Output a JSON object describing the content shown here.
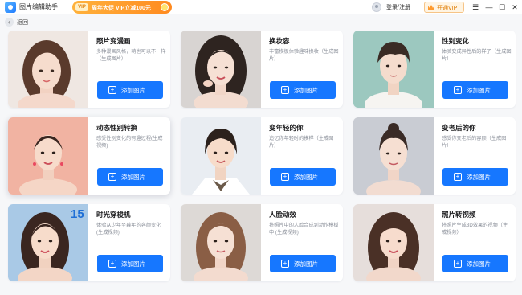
{
  "app": {
    "title": "图片编辑助手",
    "promo": {
      "vip_tag": "VIP",
      "text": "周年大促 VIP立减100元"
    },
    "login": "登录/注册",
    "vip_button": "开通VIP",
    "window_controls": {
      "menu": "☰",
      "minimize": "—",
      "maximize": "☐",
      "close": "✕"
    }
  },
  "nav": {
    "back_icon": "‹",
    "back_label": "返回"
  },
  "cards": [
    {
      "title": "照片变漫画",
      "desc": "多种漫画风格，萌也可以不一样（生成图片）",
      "button": "添加图片",
      "icon": "plus-icon"
    },
    {
      "title": "换妆容",
      "desc": "丰富模板体验趣味换妆（生成图片）",
      "button": "添加图片",
      "icon": "plus-icon"
    },
    {
      "title": "性别变化",
      "desc": "体验变成异性后的样子（生成图片）",
      "button": "添加图片",
      "icon": "plus-icon"
    },
    {
      "title": "动态性别转换",
      "desc": "感受性别变化的有趣过程(生成视频)",
      "button": "添加图片",
      "icon": "plus-icon"
    },
    {
      "title": "变年轻的你",
      "desc": "追忆你年轻时的模样（生成图片）",
      "button": "添加图片",
      "icon": "plus-icon"
    },
    {
      "title": "变老后的你",
      "desc": "感受你变老后的容颜（生成图片）",
      "button": "添加图片",
      "icon": "plus-icon"
    },
    {
      "title": "时光穿梭机",
      "desc": "体验从少年至暮年的容颜变化 (生成视频)",
      "button": "添加图片",
      "icon": "plus-icon",
      "badge": "15"
    },
    {
      "title": "人脸动效",
      "desc": "将照片中的人脸合成到动作模板中 (生成视频)",
      "button": "添加图片",
      "icon": "plus-icon"
    },
    {
      "title": "照片转视频",
      "desc": "将照片生成3D效果的视频（生成视频）",
      "button": "添加图片",
      "icon": "plus-icon"
    }
  ],
  "colors": {
    "accent": "#1677ff",
    "promo": "#ff8a1f",
    "background": "#f6f7f9"
  }
}
